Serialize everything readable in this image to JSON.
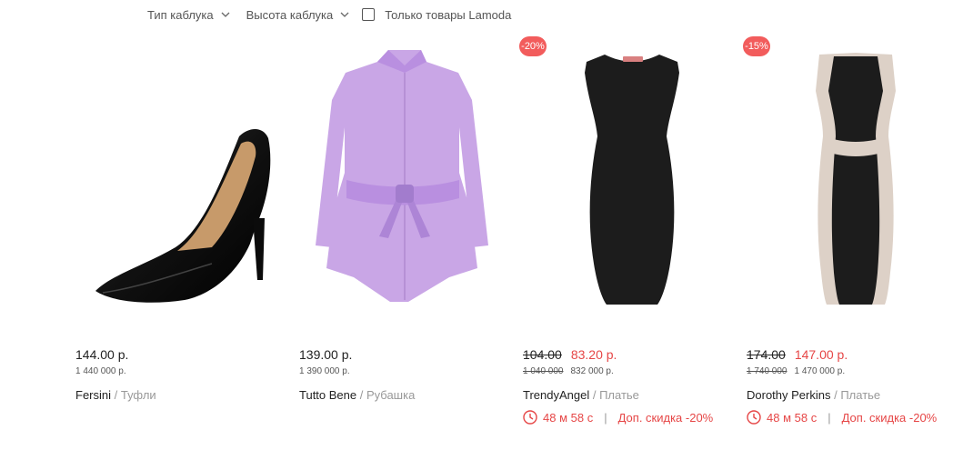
{
  "filters": {
    "heel_type": "Тип каблука",
    "heel_height": "Высота каблука",
    "only_lamoda": "Только товары Lamoda"
  },
  "products": [
    {
      "price": "144.00 р.",
      "price_sub": "1 440 000 р.",
      "brand": "Fersini",
      "category": "/ Туфли"
    },
    {
      "price": "139.00 р.",
      "price_sub": "1 390 000 р.",
      "brand": "Tutto Bene",
      "category": "/ Рубашка"
    },
    {
      "badge": "-20%",
      "old_price": "104.00",
      "price": "83.20 р.",
      "old_sub": "1 040 000",
      "price_sub": "832 000 р.",
      "brand": "TrendyAngel",
      "category": "/ Платье",
      "timer": "48 м 58 с",
      "extra": "Доп. скидка -20%"
    },
    {
      "badge": "-15%",
      "old_price": "174.00",
      "price": "147.00 р.",
      "old_sub": "1 740 000",
      "price_sub": "1 470 000 р.",
      "brand": "Dorothy Perkins",
      "category": "/ Платье",
      "timer": "48 м 58 с",
      "extra": "Доп. скидка -20%"
    }
  ],
  "colors": {
    "sale": "#e64646",
    "badge": "#f25c5c",
    "shirt": "#c9a6e6"
  }
}
